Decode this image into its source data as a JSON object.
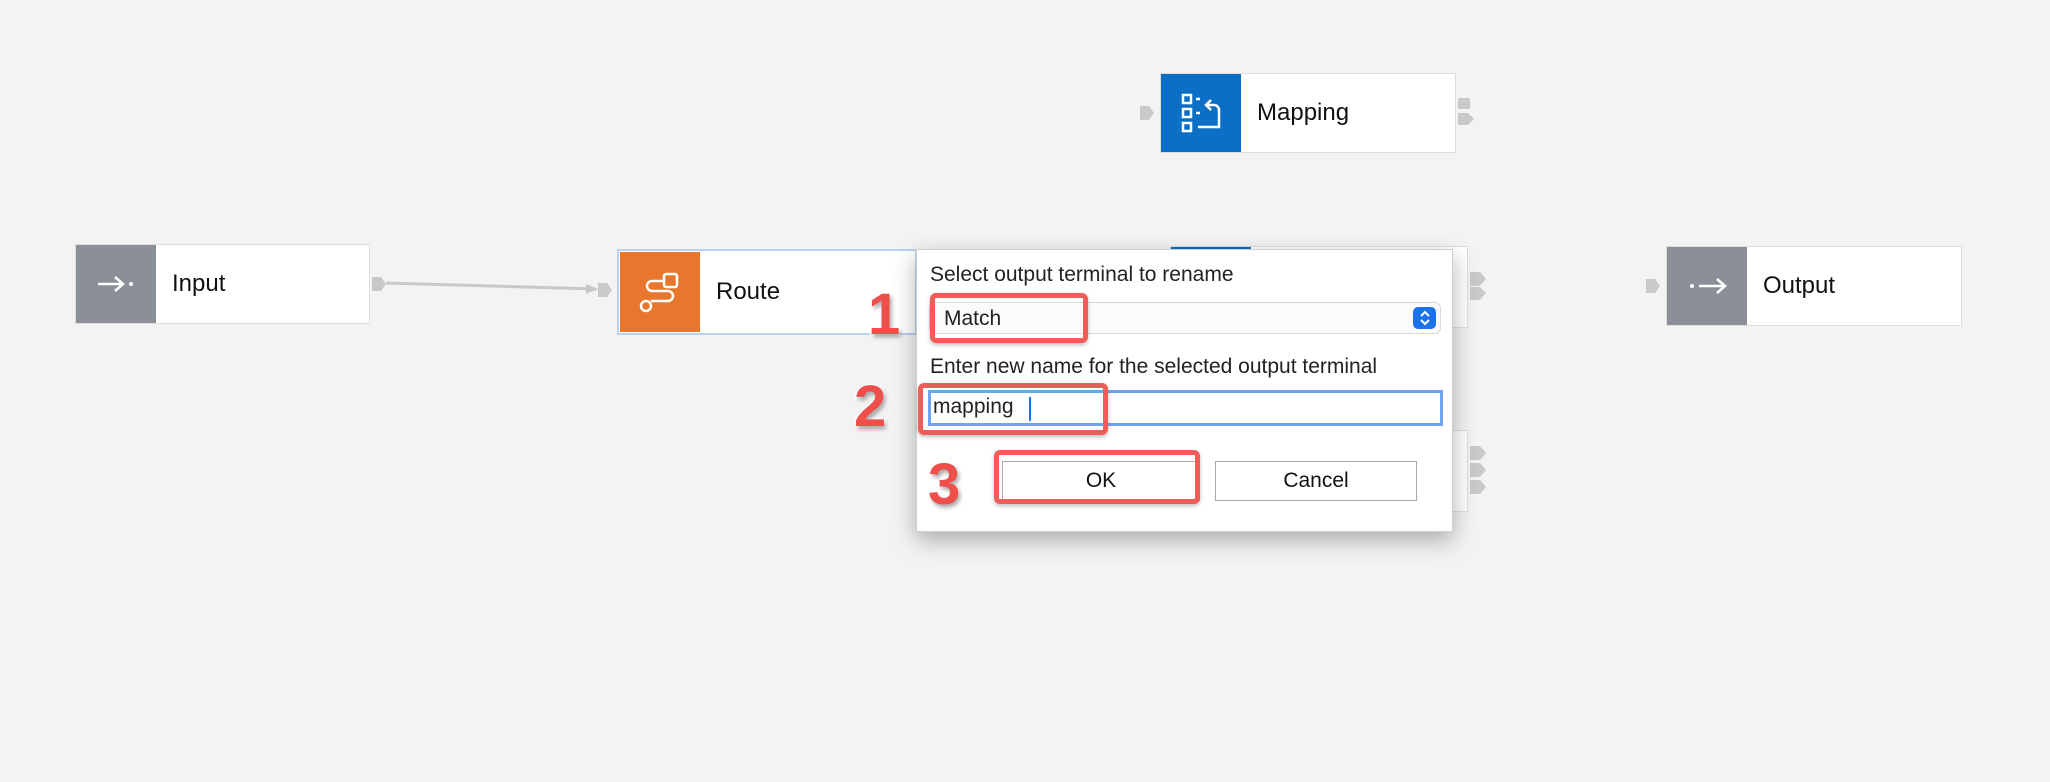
{
  "canvas": {
    "nodes": {
      "input": {
        "label": "Input",
        "icon": "input-arrow-icon",
        "color": "#8a8f98"
      },
      "route": {
        "label": "Route",
        "icon": "route-icon",
        "color": "#e8762c"
      },
      "mapping": {
        "label": "Mapping",
        "icon": "mapping-icon",
        "color": "#0b6fc6"
      },
      "output": {
        "label": "Output",
        "icon": "output-arrow-icon",
        "color": "#8a8f98"
      }
    }
  },
  "dialog": {
    "select_prompt": "Select output terminal to rename",
    "selected_terminal": "Match",
    "name_prompt": "Enter new name for the selected output terminal",
    "new_name_value": "mapping",
    "ok_label": "OK",
    "cancel_label": "Cancel"
  },
  "annotations": {
    "step1": "1",
    "step2": "2",
    "step3": "3",
    "callout_color": "#f05c57"
  }
}
